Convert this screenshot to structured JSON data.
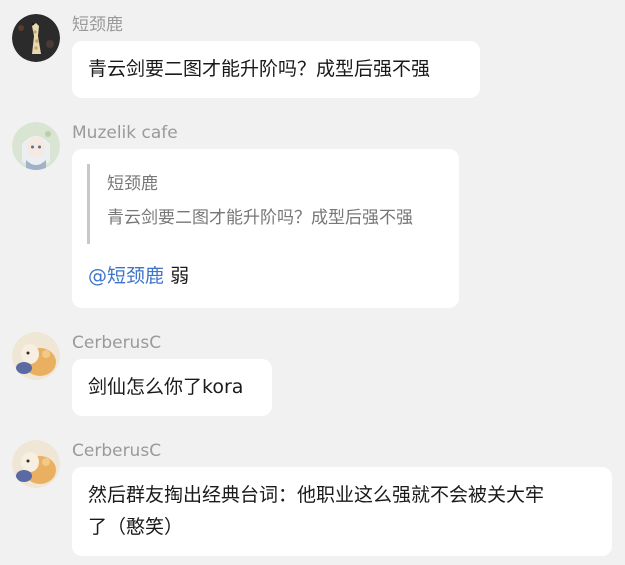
{
  "messages": [
    {
      "sender": "短颈鹿",
      "avatar_icon": "giraffe-avatar-icon",
      "text": "青云剑要二图才能升阶吗？成型后强不强"
    },
    {
      "sender": "Muzelik cafe",
      "avatar_icon": "anime-girl-avatar-icon",
      "quote": {
        "author": "短颈鹿",
        "text": "青云剑要二图才能升阶吗？成型后强不强"
      },
      "mention": "@短颈鹿",
      "text": "弱"
    },
    {
      "sender": "CerberusC",
      "avatar_icon": "fluffy-creature-avatar-icon",
      "text": "剑仙怎么你了kora"
    },
    {
      "sender": "CerberusC",
      "avatar_icon": "fluffy-creature-avatar-icon",
      "text_line1": "然后群友掏出经典台词：他职业这么强就不会被关大牢",
      "text_line2": "了（憨笑）"
    }
  ],
  "colors": {
    "background": "#f1f1f1",
    "bubble": "#ffffff",
    "mention": "#3e74c9",
    "sender_name": "#9a9a9a"
  }
}
